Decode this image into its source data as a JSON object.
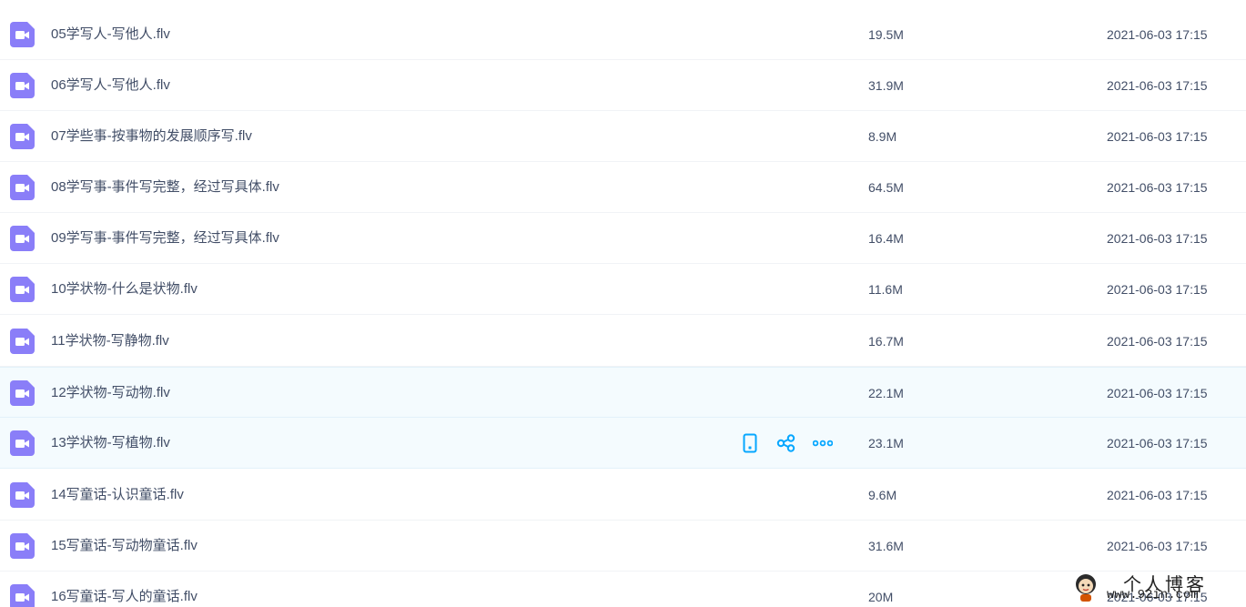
{
  "files": [
    {
      "name": "05学写人-写他人.flv",
      "size": "19.5M",
      "date": "2021-06-03 17:15"
    },
    {
      "name": "06学写人-写他人.flv",
      "size": "31.9M",
      "date": "2021-06-03 17:15"
    },
    {
      "name": "07学些事-按事物的发展顺序写.flv",
      "size": "8.9M",
      "date": "2021-06-03 17:15"
    },
    {
      "name": "08学写事-事件写完整，经过写具体.flv",
      "size": "64.5M",
      "date": "2021-06-03 17:15"
    },
    {
      "name": "09学写事-事件写完整，经过写具体.flv",
      "size": "16.4M",
      "date": "2021-06-03 17:15"
    },
    {
      "name": "10学状物-什么是状物.flv",
      "size": "11.6M",
      "date": "2021-06-03 17:15"
    },
    {
      "name": "11学状物-写静物.flv",
      "size": "16.7M",
      "date": "2021-06-03 17:15"
    },
    {
      "name": "12学状物-写动物.flv",
      "size": "22.1M",
      "date": "2021-06-03 17:15"
    },
    {
      "name": "13学状物-写植物.flv",
      "size": "23.1M",
      "date": "2021-06-03 17:15"
    },
    {
      "name": "14写童话-认识童话.flv",
      "size": "9.6M",
      "date": "2021-06-03 17:15"
    },
    {
      "name": "15写童话-写动物童话.flv",
      "size": "31.6M",
      "date": "2021-06-03 17:15"
    },
    {
      "name": "16写童话-写人的童话.flv",
      "size": "20M",
      "date": "2021-06-03 17:15"
    }
  ],
  "row_actions": [
    {
      "icon": "phone-icon"
    },
    {
      "icon": "share-icon"
    },
    {
      "icon": "more-icon"
    }
  ],
  "file_icon": "video-file-icon",
  "colors": {
    "icon_purple": "#8a7ef8",
    "action_blue": "#06a7ff",
    "text": "#424e67",
    "hover_bg": "#f4fbfe"
  },
  "watermark": {
    "title": "个人博客",
    "url": "www.92in.com"
  }
}
